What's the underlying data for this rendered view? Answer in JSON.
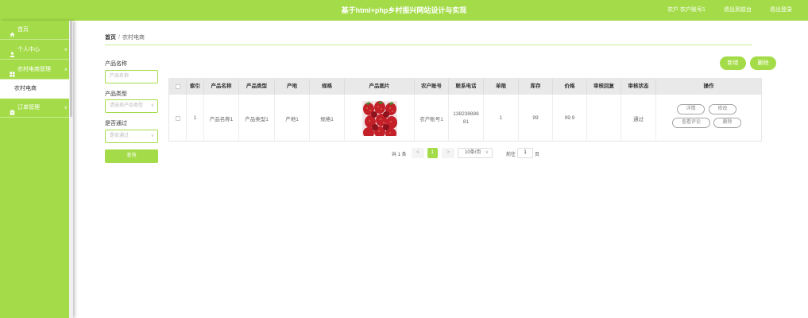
{
  "header": {
    "title": "基于html+php乡村振兴网站设计与实现",
    "user": "农户 农户账号1",
    "back_to_admin": "退出到前台",
    "logout": "退出登录"
  },
  "sidebar": {
    "items": [
      {
        "label": "首页",
        "icon": "home-icon"
      },
      {
        "label": "个人中心",
        "icon": "user-icon"
      },
      {
        "label": "农村电商管理",
        "icon": "grid-icon",
        "sub": "农村电商"
      },
      {
        "label": "订单管理",
        "icon": "order-icon"
      }
    ]
  },
  "breadcrumb": {
    "home": "首页",
    "current": "农村电商"
  },
  "search": {
    "name_label": "产品名称",
    "name_placeholder": "产品名称",
    "type_label": "产品类型",
    "type_placeholder": "请选择产品类型",
    "pass_label": "是否通过",
    "pass_placeholder": "是否通过",
    "query_btn": "查询"
  },
  "toolbar": {
    "add": "新增",
    "delete": "删除"
  },
  "table": {
    "headers": [
      "索引",
      "产品名称",
      "产品类型",
      "产地",
      "规格",
      "产品图片",
      "农户账号",
      "联系电话",
      "单限",
      "库存",
      "价格",
      "审核回复",
      "审核状态",
      "操作"
    ],
    "rows": [
      {
        "index": "1",
        "name": "产品名称1",
        "type": "产品类型1",
        "origin": "产地1",
        "spec": "规格1",
        "farmer": "农户账号1",
        "phone1": "138238888",
        "phone2": "81",
        "limit": "1",
        "stock": "99",
        "price": "99.9",
        "reply": "",
        "status": "通过",
        "actions": {
          "detail": "详情",
          "edit": "修改",
          "review": "查看评论",
          "delete": "删除"
        }
      }
    ]
  },
  "pagination": {
    "total": "共 1 条",
    "prev": "<",
    "page": "1",
    "next": ">",
    "size": "10条/页",
    "goto": "前往",
    "goto_value": "1",
    "page_suffix": "页"
  },
  "colors": {
    "accent": "#a4dc49"
  }
}
